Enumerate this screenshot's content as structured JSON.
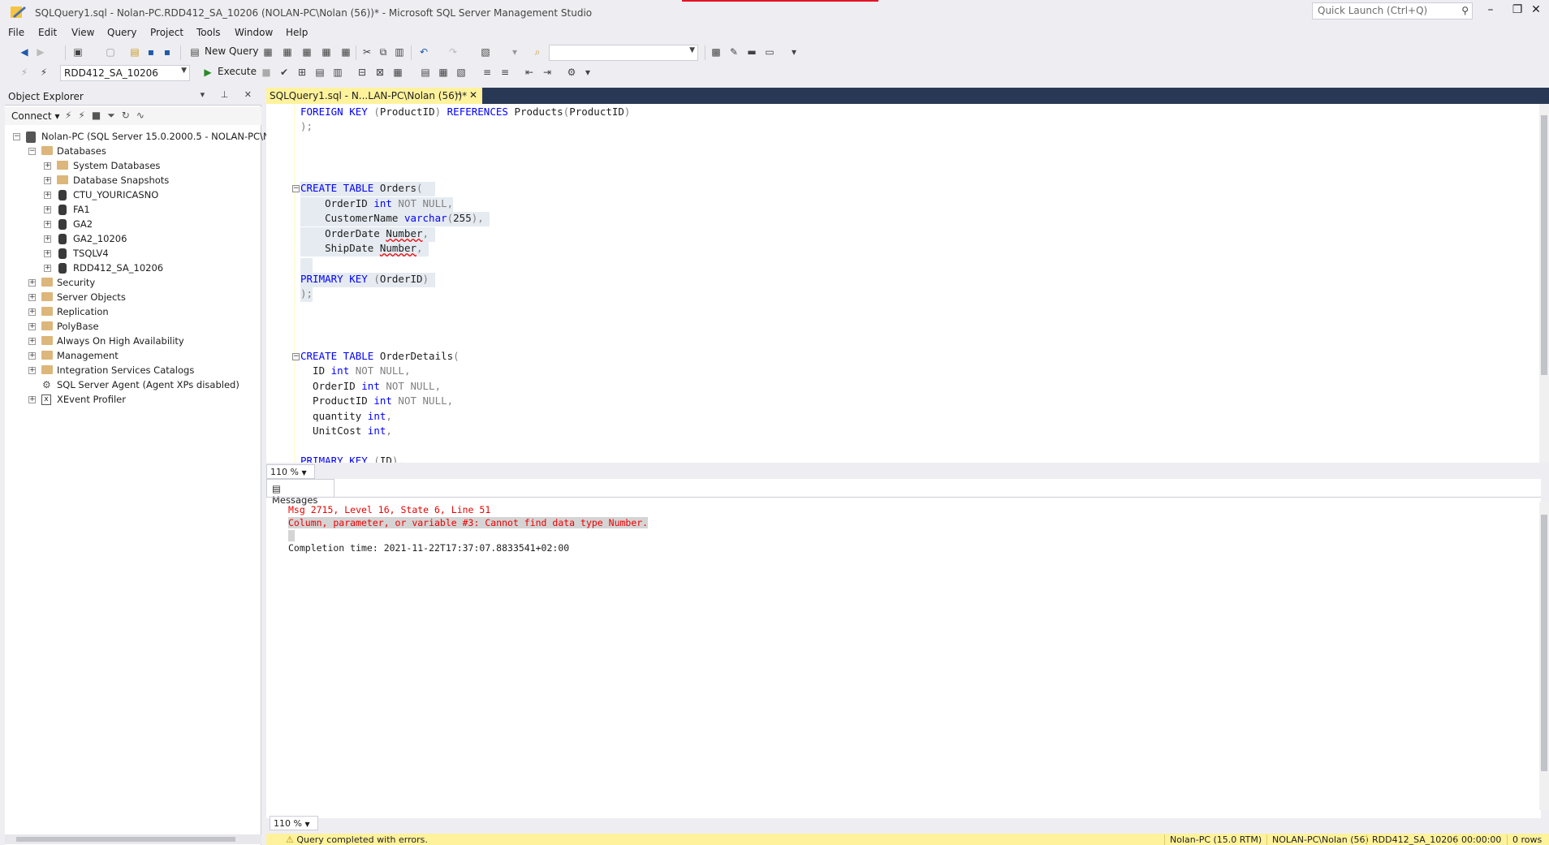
{
  "window": {
    "title": "SQLQuery1.sql - Nolan-PC.RDD412_SA_10206 (NOLAN-PC\\Nolan (56))* - Microsoft SQL Server Management Studio",
    "quick_launch_placeholder": "Quick Launch (Ctrl+Q)"
  },
  "menu": [
    "File",
    "Edit",
    "View",
    "Query",
    "Project",
    "Tools",
    "Window",
    "Help"
  ],
  "toolbar": {
    "new_query": "New Query",
    "execute": "Execute",
    "database_combo": "RDD412_SA_10206"
  },
  "object_explorer": {
    "title": "Object Explorer",
    "connect": "Connect",
    "server": "Nolan-PC (SQL Server 15.0.2000.5 - NOLAN-PC\\No",
    "items": {
      "databases": "Databases",
      "system_databases": "System Databases",
      "database_snapshots": "Database Snapshots",
      "db1": "CTU_YOURICASNO",
      "db2": "FA1",
      "db3": "GA2",
      "db4": "GA2_10206",
      "db5": "TSQLV4",
      "db6": "RDD412_SA_10206",
      "security": "Security",
      "server_objects": "Server Objects",
      "replication": "Replication",
      "polybase": "PolyBase",
      "always_on": "Always On High Availability",
      "management": "Management",
      "integration": "Integration Services Catalogs",
      "agent": "SQL Server Agent (Agent XPs disabled)",
      "xevent": "XEvent Profiler"
    }
  },
  "editor": {
    "tab_title": "SQLQuery1.sql - N...LAN-PC\\Nolan (56))*",
    "zoom": "110 %"
  },
  "results": {
    "tab": "Messages",
    "msg_header": "Msg 2715, Level 16, State 6, Line 51",
    "msg_error": "Column, parameter, or variable #3: Cannot find data type Number.",
    "completion": "Completion time: 2021-11-22T17:37:07.8833541+02:00",
    "zoom": "110 %"
  },
  "status": {
    "message": "Query completed with errors.",
    "server": "Nolan-PC (15.0 RTM)",
    "user": "NOLAN-PC\\Nolan (56)",
    "database": "RDD412_SA_10206",
    "time": "00:00:00",
    "rows": "0 rows"
  }
}
